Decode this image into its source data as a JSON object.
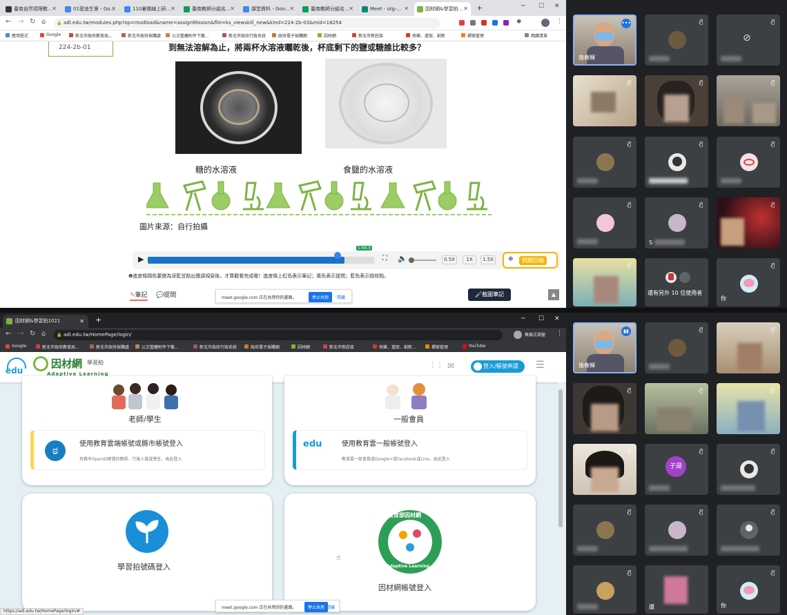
{
  "top": {
    "tabs": [
      "臺南自然領理教...",
      "01愛迪生第 - Go...",
      "110暑期線上研...",
      "臺南教師分組名...",
      "課堂資料 - Goo...",
      "臺南教師分組名...",
      "Meet - utg-...",
      "因材網&學習拍..."
    ],
    "url": "adl.edu.tw/modules.php?op=modload&name=assignMission&file=ks_viewskill_new&kind=224-2b-03&mid=18254",
    "bookmarks": [
      "應用程式",
      "Google",
      "新北市政府教育局...",
      "新北市政府採購處",
      "公文整繳附件下載...",
      "新北市政府行政系統",
      "政府電子採購網",
      "因材網",
      "新北市新莊區",
      "快樂．進取．創新",
      "標案管理"
    ],
    "reading_list": "閱讀清單",
    "node_code": "224-2b-01",
    "question": "到無法溶解為止，將兩杯水溶液曬乾後，杯底剩下的鹽或糖誰比較多？",
    "caption_sugar": "糖的水溶液",
    "caption_salt": "食鹽的水溶液",
    "source": "圖片來源：自行拍攝",
    "player": {
      "marker": "1:04.5",
      "speeds": [
        "0.5X",
        "1X",
        "1.5X"
      ],
      "progress": 0.87,
      "qa_btn": "問題回報"
    },
    "hint": "❶進度條顏色要變為深藍並點出聲語視窗後，才算觀看完成喔！進度條上紅色表示筆記；黃色表示提問；藍色表示檢核點。",
    "notes_tab": "筆記",
    "ask_tab": "提問",
    "screenshot_btn": "截圖筆記",
    "share_bar": {
      "text": "meet.google.com 正在共用你的畫面。",
      "stop": "停止共用",
      "hide": "隱藏"
    }
  },
  "bottom": {
    "tabs": [
      "因材網&學習拍1021"
    ],
    "url": "adl.edu.tw/HomePage/login/",
    "incognito": "無痕式視窗",
    "bookmarks": [
      "Google",
      "新北市政府教育局...",
      "新北市政府採購處",
      "公文整繳附件下載...",
      "新北市政府行政系統",
      "政府電子採購網",
      "因材網",
      "新北市新莊區",
      "快樂．進取．創新...",
      "標案管理",
      "YouTube"
    ],
    "logo_main": "因材網",
    "logo_sub": "學習拍",
    "logo_en": "Adaptive Learning",
    "login_btn": "登入/帳號申請",
    "card_teacher": "老師/學生",
    "card_member": "一般會員",
    "login_cloud_county": "使用教育雲端帳號或縣市帳號登入",
    "login_cloud_county_desc": "有縣市OpenID帳號的教師、行政人員或學生，由此登入",
    "login_cloud_general": "使用教育雲一般帳號登入",
    "login_cloud_general_desc": "教育雲一般會員或Google+或Facebook或Line，由此登入",
    "login_xuexipai": "學習拍號碼登入",
    "login_adl": "因材網帳號登入",
    "badge_top": "教育部因材網",
    "badge_bottom": "Adaptive Learning",
    "status_url": "https://adl.edu.tw/HomePage/login/#",
    "share_bar": {
      "text": "meet.google.com 正在共用你的畫面。",
      "stop": "停止共用",
      "hide": "隱藏"
    }
  },
  "meet_top": {
    "host": "施春輝",
    "others": "還有另外 10 位使用者",
    "you": "你",
    "names": [
      "",
      "",
      "",
      "",
      "",
      "",
      "",
      "",
      "S",
      "",
      ""
    ]
  },
  "meet_bottom": {
    "host": "施春輝",
    "zisheng": "子晟",
    "you": "你",
    "other_label": "還"
  }
}
